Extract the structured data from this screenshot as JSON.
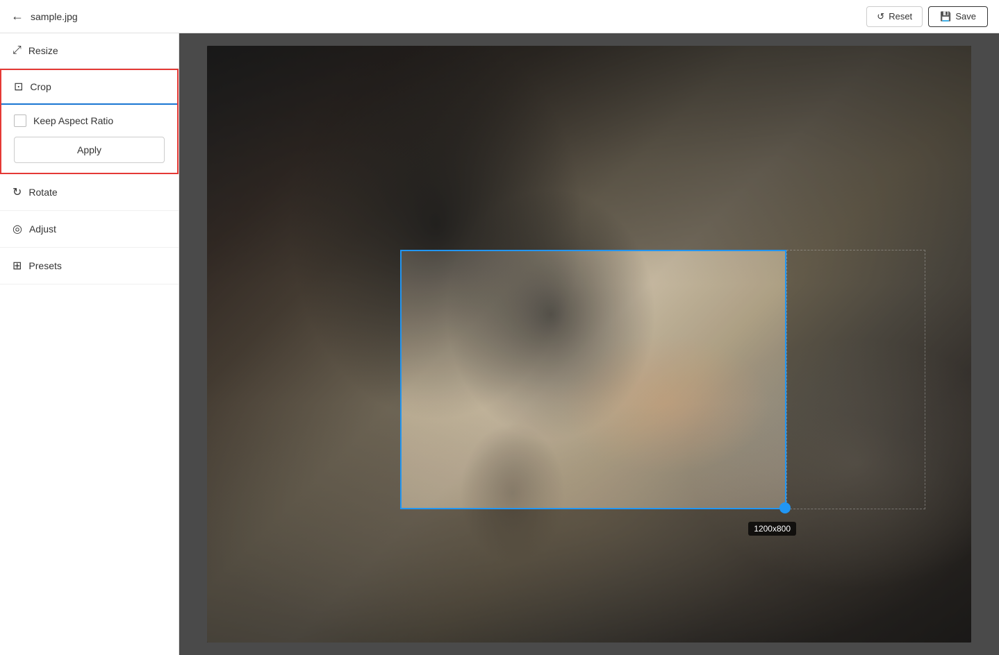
{
  "header": {
    "filename": "sample.jpg",
    "back_label": "←",
    "reset_label": "Reset",
    "save_label": "Save"
  },
  "sidebar": {
    "items": [
      {
        "id": "resize",
        "label": "Resize",
        "icon": "⤢"
      },
      {
        "id": "crop",
        "label": "Crop",
        "icon": "⊡"
      },
      {
        "id": "rotate",
        "label": "Rotate",
        "icon": "↻"
      },
      {
        "id": "adjust",
        "label": "Adjust",
        "icon": "◎"
      },
      {
        "id": "presets",
        "label": "Presets",
        "icon": "⊞"
      }
    ],
    "crop_panel": {
      "keep_aspect_ratio_label": "Keep Aspect Ratio",
      "apply_label": "Apply"
    }
  },
  "canvas": {
    "size_tooltip": "1200x800"
  },
  "icons": {
    "reset": "↺",
    "save": "💾",
    "back": "←",
    "resize": "⤢",
    "crop": "⊡",
    "rotate": "↻",
    "adjust": "◎",
    "presets": "⊞"
  }
}
